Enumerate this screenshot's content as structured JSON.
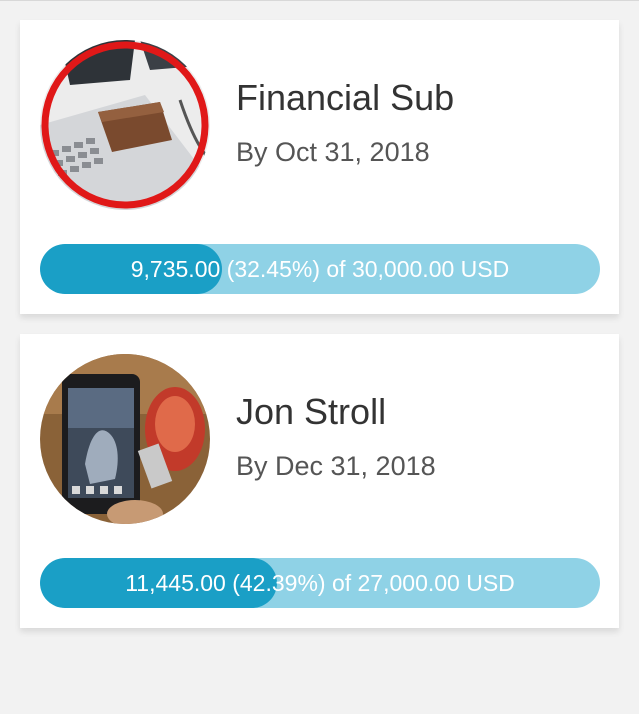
{
  "cards": [
    {
      "title": "Financial Sub",
      "subtitle": "By Oct 31, 2018",
      "progress": {
        "fraction": 0.3245,
        "label": "9,735.00 (32.45%) of 30,000.00 USD"
      }
    },
    {
      "title": "Jon Stroll",
      "subtitle": "By Dec 31, 2018",
      "progress": {
        "fraction": 0.4239,
        "label": "11,445.00 (42.39%) of 27,000.00 USD"
      }
    }
  ],
  "colors": {
    "progress_fill": "#1a9fc6",
    "progress_track": "#8fd2e6",
    "card_background": "#ffffff",
    "page_background": "#f2f2f2"
  }
}
